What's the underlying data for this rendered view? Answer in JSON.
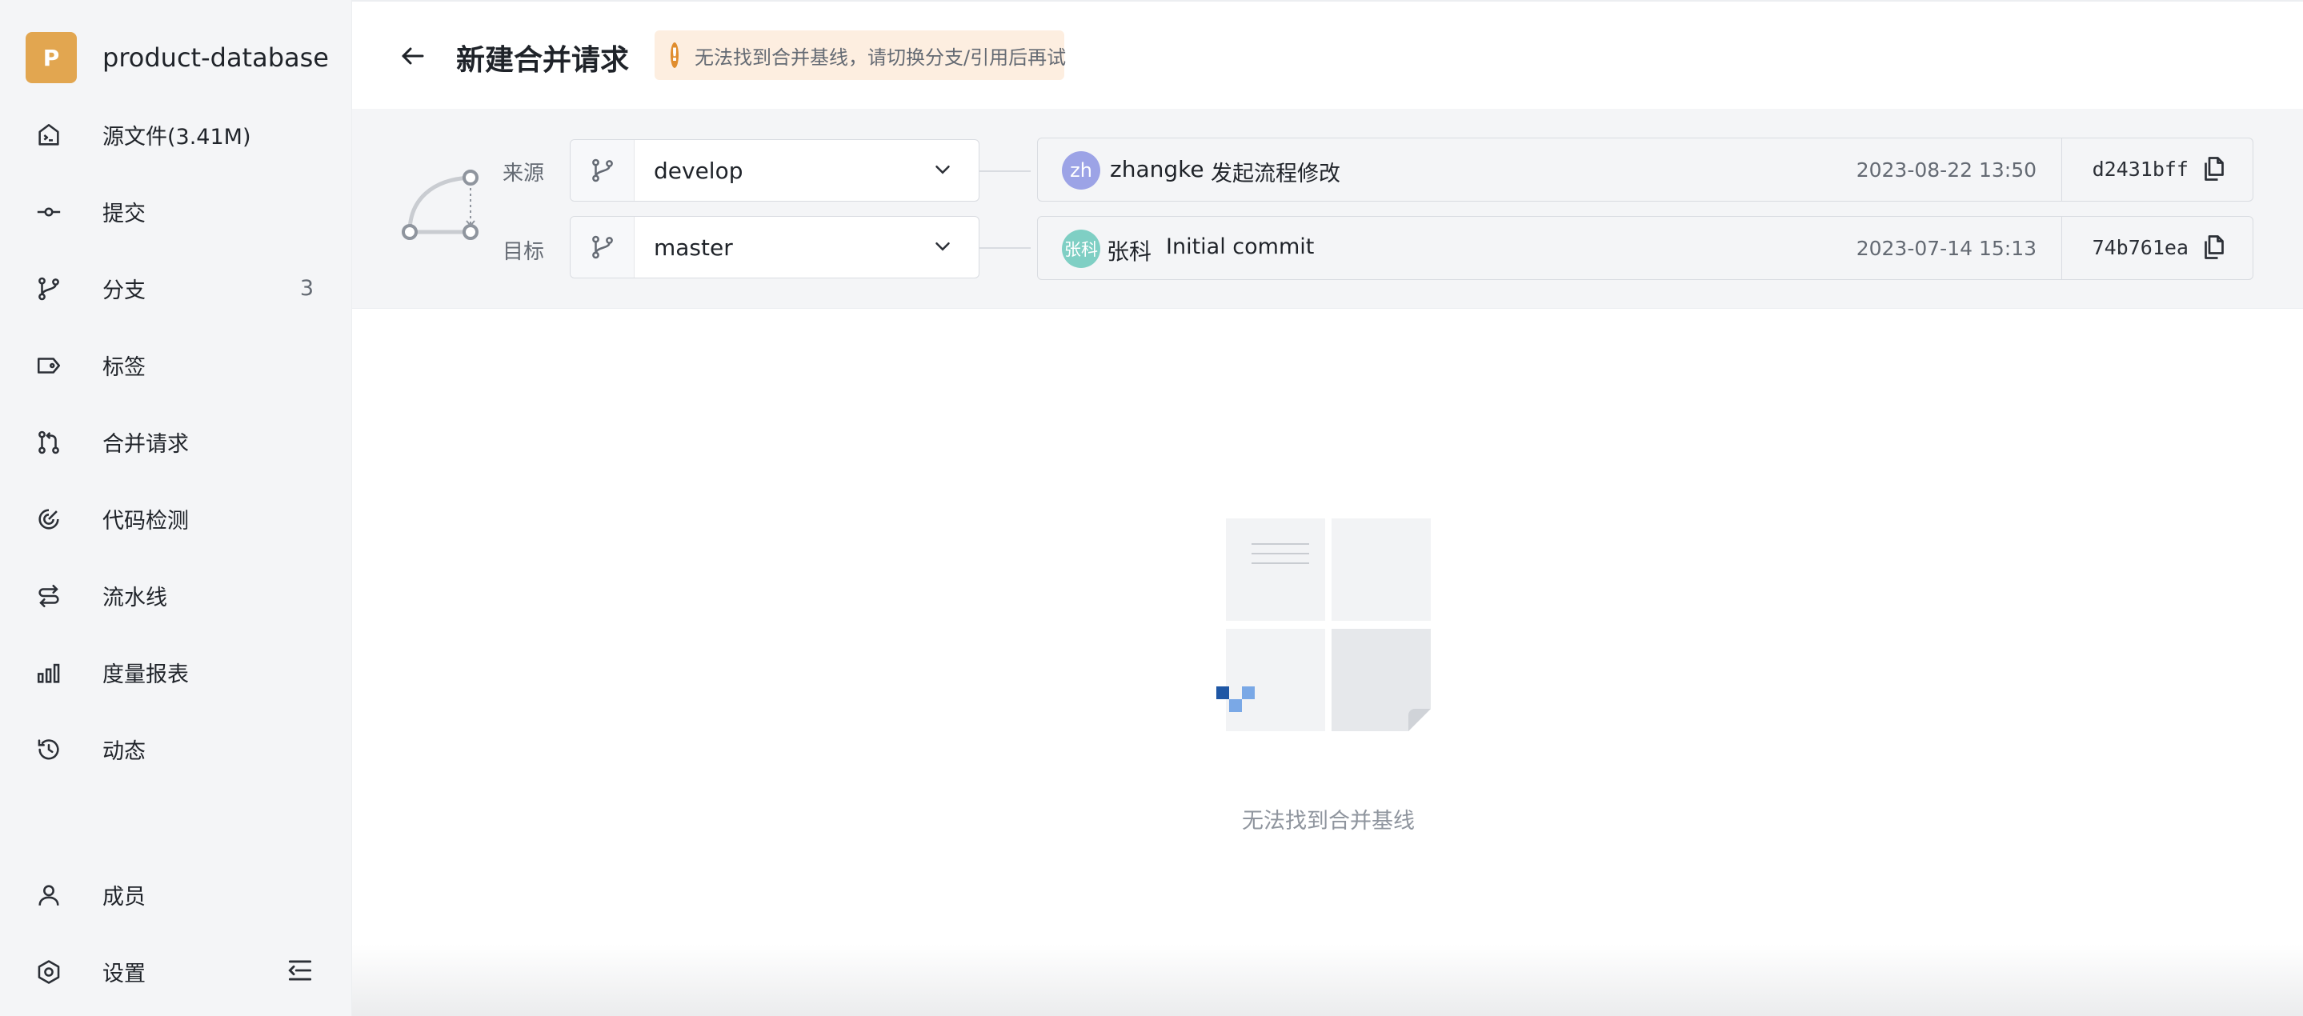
{
  "repo": {
    "initial": "P",
    "name": "product-database",
    "avatar_color": "#e2a650"
  },
  "sidebar": {
    "items": [
      {
        "label": "源文件(3.41M)",
        "icon": "code-file-icon"
      },
      {
        "label": "提交",
        "icon": "commit-icon"
      },
      {
        "label": "分支",
        "icon": "branch-icon",
        "count": "3"
      },
      {
        "label": "标签",
        "icon": "tag-icon"
      },
      {
        "label": "合并请求",
        "icon": "merge-request-icon"
      },
      {
        "label": "代码检测",
        "icon": "scan-icon"
      },
      {
        "label": "流水线",
        "icon": "pipeline-icon"
      },
      {
        "label": "度量报表",
        "icon": "bar-chart-icon"
      },
      {
        "label": "动态",
        "icon": "history-icon"
      }
    ],
    "bottom_items": [
      {
        "label": "成员",
        "icon": "user-icon"
      },
      {
        "label": "设置",
        "icon": "settings-icon"
      }
    ]
  },
  "header": {
    "title": "新建合并请求",
    "warning": "无法找到合并基线，请切换分支/引用后再试",
    "warning_color": "#e08d2e"
  },
  "compare": {
    "source": {
      "label": "来源",
      "branch": "develop",
      "commit": {
        "avatar_text": "zh",
        "avatar_color": "#9ca3e6",
        "author": "zhangke",
        "message": "发起流程修改",
        "date": "2023-08-22 13:50",
        "sha": "d2431bff"
      }
    },
    "target": {
      "label": "目标",
      "branch": "master",
      "commit": {
        "avatar_text": "张科",
        "avatar_color": "#7fcfc4",
        "author": "张科",
        "message": "Initial commit",
        "date": "2023-07-14 15:13",
        "sha": "74b761ea"
      }
    }
  },
  "empty_state": {
    "message": "无法找到合并基线"
  }
}
